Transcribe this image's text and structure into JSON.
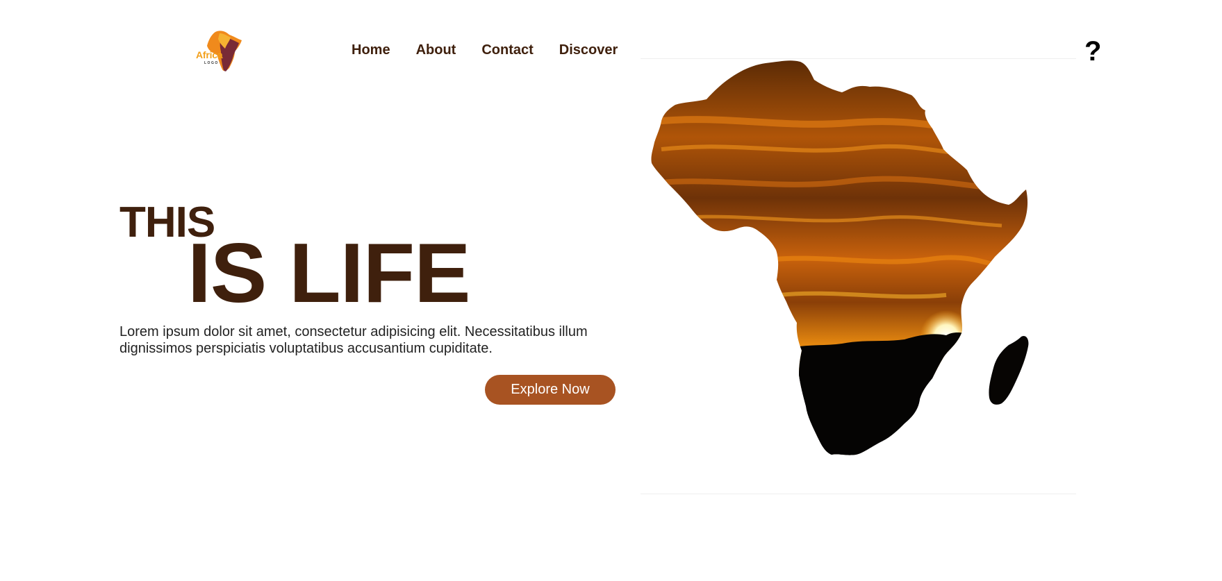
{
  "logo": {
    "text": "Africa",
    "sub": "LOGO"
  },
  "nav": {
    "items": [
      {
        "label": "Home"
      },
      {
        "label": "About"
      },
      {
        "label": "Contact"
      },
      {
        "label": "Discover"
      }
    ]
  },
  "help": {
    "label": "?",
    "icon": "question-mark-icon"
  },
  "hero": {
    "line1": "THIS",
    "line2": "IS LIFE",
    "description": "Lorem ipsum dolor sit amet, consectetur adipisicing elit. Necessitatibus illum dignissimos perspiciatis voluptatibus accusantium cupiditate.",
    "cta_label": "Explore Now"
  },
  "colors": {
    "brand_brown": "#3f200d",
    "button": "#a85322",
    "sunset_orange": "#e8820e",
    "logo_orange": "#f2a01c"
  },
  "image": {
    "icon": "africa-map-sunset-image"
  }
}
